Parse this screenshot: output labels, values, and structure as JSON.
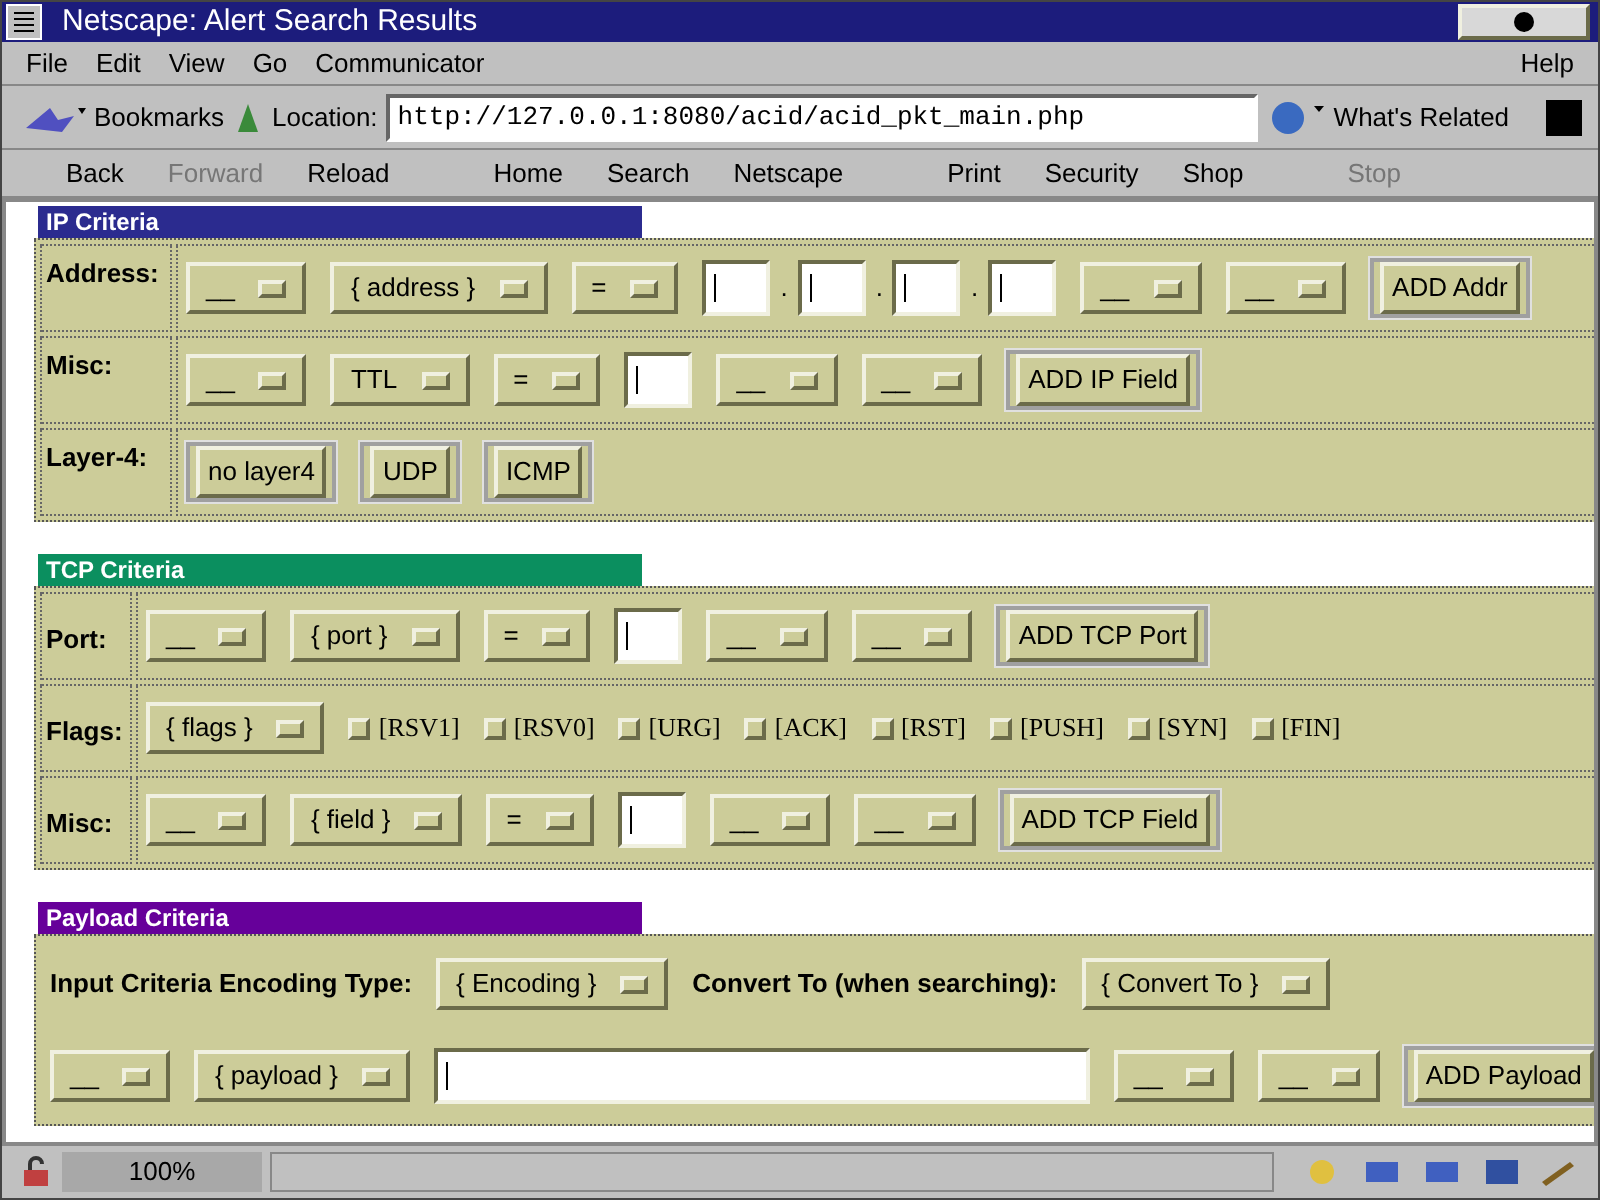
{
  "window": {
    "title": "Netscape: Alert Search Results"
  },
  "menu": {
    "items": [
      "File",
      "Edit",
      "View",
      "Go",
      "Communicator"
    ],
    "help": "Help"
  },
  "location_bar": {
    "bookmarks": "Bookmarks",
    "label": "Location:",
    "url": "http://127.0.0.1:8080/acid/acid_pkt_main.php",
    "whats_related": "What's Related"
  },
  "nav_buttons": [
    {
      "label": "Back",
      "disabled": false
    },
    {
      "label": "Forward",
      "disabled": true
    },
    {
      "label": "Reload",
      "disabled": false
    },
    {
      "label": "Home",
      "disabled": false
    },
    {
      "label": "Search",
      "disabled": false
    },
    {
      "label": "Netscape",
      "disabled": false
    },
    {
      "label": "Print",
      "disabled": false
    },
    {
      "label": "Security",
      "disabled": false
    },
    {
      "label": "Shop",
      "disabled": false
    },
    {
      "label": "Stop",
      "disabled": true
    }
  ],
  "sections": [
    {
      "title": "IP Criteria",
      "color": "#2b2b8f",
      "rows": [
        {
          "label": "Address:",
          "items": [
            {
              "kind": "select",
              "text": "__"
            },
            {
              "kind": "select",
              "text": "{ address }"
            },
            {
              "kind": "select",
              "text": "="
            },
            {
              "kind": "input"
            },
            {
              "kind": "dot",
              "text": "."
            },
            {
              "kind": "input"
            },
            {
              "kind": "dot",
              "text": "."
            },
            {
              "kind": "input"
            },
            {
              "kind": "dot",
              "text": "."
            },
            {
              "kind": "input"
            },
            {
              "kind": "select",
              "text": "__"
            },
            {
              "kind": "select",
              "text": "__"
            },
            {
              "kind": "button",
              "text": "ADD Addr"
            }
          ]
        },
        {
          "label": "Misc:",
          "items": [
            {
              "kind": "select",
              "text": "__"
            },
            {
              "kind": "select",
              "text": "TTL"
            },
            {
              "kind": "select",
              "text": "="
            },
            {
              "kind": "input"
            },
            {
              "kind": "select",
              "text": "__"
            },
            {
              "kind": "select",
              "text": "__"
            },
            {
              "kind": "button",
              "text": "ADD IP Field"
            }
          ]
        },
        {
          "label": "Layer-4:",
          "items": [
            {
              "kind": "button",
              "text": "no layer4"
            },
            {
              "kind": "button",
              "text": "UDP"
            },
            {
              "kind": "button",
              "text": "ICMP"
            }
          ]
        }
      ]
    },
    {
      "title": "TCP Criteria",
      "color": "#0b8f5f",
      "rows": [
        {
          "label": "Port:",
          "items": [
            {
              "kind": "select",
              "text": "__"
            },
            {
              "kind": "select",
              "text": "{ port }"
            },
            {
              "kind": "select",
              "text": "="
            },
            {
              "kind": "input"
            },
            {
              "kind": "select",
              "text": "__"
            },
            {
              "kind": "select",
              "text": "__"
            },
            {
              "kind": "button",
              "text": "ADD TCP Port"
            }
          ]
        },
        {
          "label": "Flags:",
          "items": [
            {
              "kind": "select",
              "text": "{ flags }"
            },
            {
              "kind": "checkbox",
              "text": "[RSV1]",
              "checked": false
            },
            {
              "kind": "checkbox",
              "text": "[RSV0]",
              "checked": false
            },
            {
              "kind": "checkbox",
              "text": "[URG]",
              "checked": false
            },
            {
              "kind": "checkbox",
              "text": "[ACK]",
              "checked": false
            },
            {
              "kind": "checkbox",
              "text": "[RST]",
              "checked": false
            },
            {
              "kind": "checkbox",
              "text": "[PUSH]",
              "checked": false
            },
            {
              "kind": "checkbox",
              "text": "[SYN]",
              "checked": false
            },
            {
              "kind": "checkbox",
              "text": "[FIN]",
              "checked": false
            }
          ]
        },
        {
          "label": "Misc:",
          "items": [
            {
              "kind": "select",
              "text": "__"
            },
            {
              "kind": "select",
              "text": "{ field }"
            },
            {
              "kind": "select",
              "text": "="
            },
            {
              "kind": "input"
            },
            {
              "kind": "select",
              "text": "__"
            },
            {
              "kind": "select",
              "text": "__"
            },
            {
              "kind": "button",
              "text": "ADD TCP Field"
            }
          ]
        }
      ]
    },
    {
      "title": "Payload Criteria",
      "color": "#66009a",
      "rows": [
        {
          "items": [
            {
              "kind": "text",
              "text": "Input Criteria Encoding Type:"
            },
            {
              "kind": "select",
              "text": "{ Encoding }"
            },
            {
              "kind": "text",
              "text": "Convert To (when searching):"
            },
            {
              "kind": "select",
              "text": "{ Convert To }"
            }
          ]
        },
        {
          "items": [
            {
              "kind": "select",
              "text": "__"
            },
            {
              "kind": "select",
              "text": "{ payload }"
            },
            {
              "kind": "wideinput"
            },
            {
              "kind": "select",
              "text": "__"
            },
            {
              "kind": "select",
              "text": "__"
            },
            {
              "kind": "button",
              "text": "ADD Payload"
            }
          ]
        }
      ]
    }
  ],
  "status_bar": {
    "zoom": "100%"
  }
}
